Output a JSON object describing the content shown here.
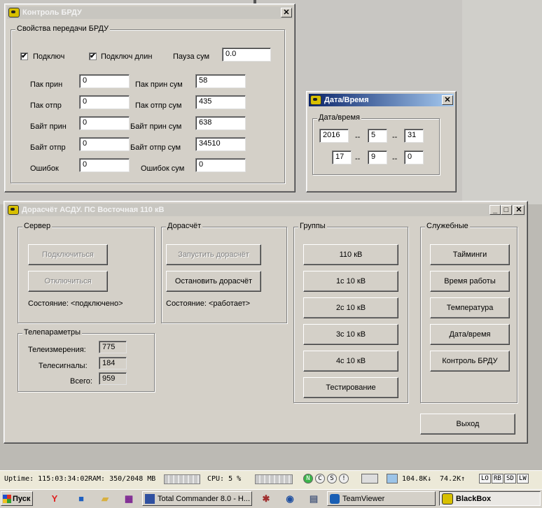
{
  "brdu": {
    "title": "Контроль БРДУ",
    "group_label": "Свойства передачи БРДУ",
    "chk1_label": "Подключ",
    "chk2_label": "Подключ длин",
    "pause_label": "Пауза сум",
    "pause_value": "0.0",
    "rows": [
      {
        "l1": "Пак прин",
        "v1": "0",
        "l2": "Пак прин сум",
        "v2": "58"
      },
      {
        "l1": "Пак отпр",
        "v1": "0",
        "l2": "Пак отпр сум",
        "v2": "435"
      },
      {
        "l1": "Байт прин",
        "v1": "0",
        "l2": "Байт прин сум",
        "v2": "638"
      },
      {
        "l1": "Байт отпр",
        "v1": "0",
        "l2": "Байт отпр сум",
        "v2": "34510"
      },
      {
        "l1": "Ошибок",
        "v1": "0",
        "l2": "Ошибок сум",
        "v2": "0"
      }
    ],
    "close": "✕"
  },
  "datetime": {
    "title": "Дата/Время",
    "group_label": "Дата/время",
    "sep": "--",
    "date": [
      "2016",
      "5",
      "31"
    ],
    "time": [
      "17",
      "9",
      "0"
    ],
    "close": "✕"
  },
  "main": {
    "title": "Дорасчёт АСДУ. ПС Восточная 110 кВ",
    "server": {
      "label": "Сервер",
      "connect": "Подключиться",
      "disconnect": "Отключиться",
      "status": "Состояние: <подключено>"
    },
    "calc": {
      "label": "Дорасчёт",
      "start": "Запустить дорасчёт",
      "stop": "Остановить дорасчёт",
      "status": "Состояние: <работает>"
    },
    "tele": {
      "label": "Телепараметры",
      "measure_label": "Телеизмерения:",
      "measure_value": "775",
      "signal_label": "Телесигналы:",
      "signal_value": "184",
      "total_label": "Всего:",
      "total_value": "959"
    },
    "groups": {
      "label": "Группы",
      "buttons": [
        "110 кВ",
        "1с 10 кВ",
        "2с 10 кВ",
        "3с 10 кВ",
        "4с 10 кВ",
        "Тестирование"
      ]
    },
    "service": {
      "label": "Служебные",
      "buttons": [
        "Тайминги",
        "Время работы",
        "Температура",
        "Дата/время",
        "Контроль БРДУ"
      ]
    },
    "exit": "Выход",
    "min": "_",
    "max": "□",
    "close": "✕"
  },
  "statusbar": {
    "uptime": "Uptime: 115:03:34:02",
    "ram": "RAM:  350/2048 MB",
    "cpu": "CPU:   5 %",
    "n": "N",
    "c": "C",
    "s": "S",
    "i": "!",
    "down": "104.8K↓",
    "up": "74.2K↑",
    "lo": "LO",
    "rb": "RB",
    "sd": "SD",
    "lw": "LW"
  },
  "taskbar": {
    "start": "Пуск",
    "tasks": [
      "Total Commander 8.0 - H...",
      "TeamViewer",
      "BlackBox"
    ]
  }
}
